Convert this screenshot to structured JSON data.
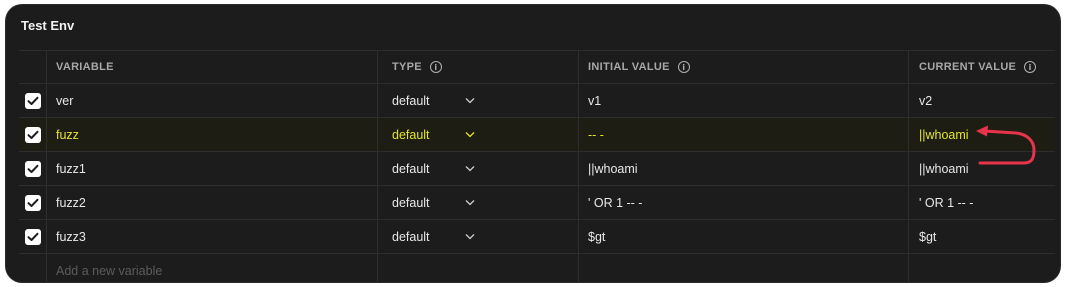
{
  "panel": {
    "title": "Test Env"
  },
  "columns": {
    "variable": "VARIABLE",
    "type": "TYPE",
    "initial_value": "INITIAL VALUE",
    "current_value": "CURRENT VALUE"
  },
  "rows": [
    {
      "checked": true,
      "variable": "ver",
      "type": "default",
      "initial": "v1",
      "current": "v2"
    },
    {
      "checked": true,
      "variable": "fuzz",
      "type": "default",
      "initial": "-- -",
      "current": "||whoami"
    },
    {
      "checked": true,
      "variable": "fuzz1",
      "type": "default",
      "initial": "||whoami",
      "current": "||whoami"
    },
    {
      "checked": true,
      "variable": "fuzz2",
      "type": "default",
      "initial": "' OR 1 -- -",
      "current": "' OR 1 -- -"
    },
    {
      "checked": true,
      "variable": "fuzz3",
      "type": "default",
      "initial": "$gt",
      "current": "$gt"
    }
  ],
  "new_variable_placeholder": "Add a new variable",
  "colors": {
    "highlight": "#e4e62a",
    "annotation_arrow": "#e8344a"
  },
  "icons": {
    "checkbox": "check-icon",
    "info": "info-icon",
    "dropdown": "chevron-down-icon"
  }
}
